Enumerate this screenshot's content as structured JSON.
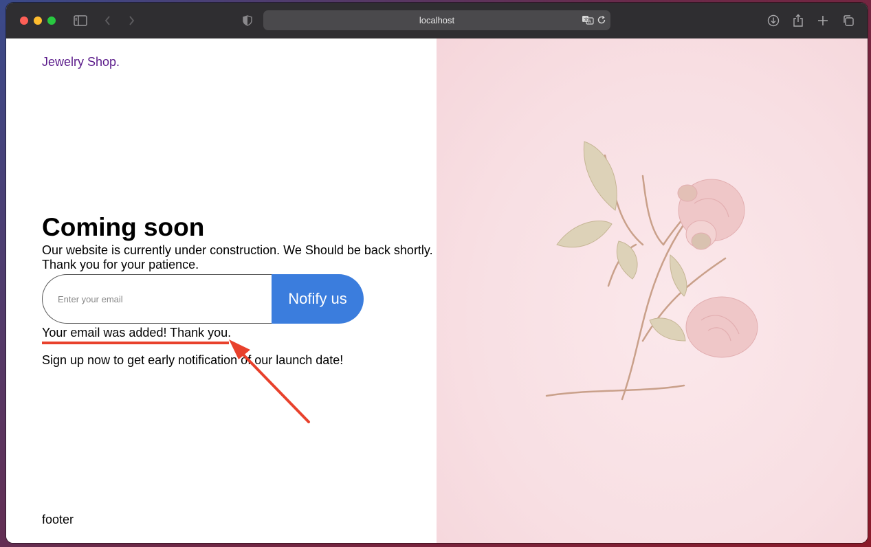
{
  "browser": {
    "address": "localhost"
  },
  "page": {
    "brand": "Jewelry Shop.",
    "title": "Coming soon",
    "subtitle_line1": "Our website is currently under construction. We Should be back shortly.",
    "subtitle_line2": "Thank you for your patience.",
    "email_placeholder": "Enter your email",
    "notify_label": "Nofify us",
    "success_message": "Your email was added! Thank you.",
    "signup_text": "Sign up now to get early notification of our launch date!",
    "footer": "footer"
  },
  "colors": {
    "brand": "#5a1a8a",
    "button": "#3b7ddd",
    "annotation": "#e8412c",
    "hero_background": "#f8dfe3"
  }
}
